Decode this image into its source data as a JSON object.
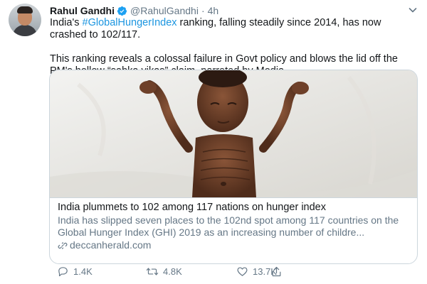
{
  "tweet": {
    "display_name": "Rahul Gandhi",
    "handle": "@RahulGandhi",
    "separator": "·",
    "time": "4h",
    "text_line1_prefix": "India's ",
    "hashtag": "#GlobalHungerIndex",
    "text_line1_suffix": " ranking, falling steadily since 2014, has now crashed to 102/117.",
    "text_paragraph2": "This ranking reveals a colossal failure in Govt policy and blows the lid off the PM's hollow “sabka vikas” claim, parroted by Modia."
  },
  "card": {
    "title": "India plummets to 102 among 117 nations on hunger index",
    "description": "India has slipped seven places to the 102nd spot among 117 countries on the Global Hunger Index (GHI) 2019 as an increasing number of childre...",
    "domain": "deccanherald.com"
  },
  "actions": {
    "reply_count": "1.4K",
    "retweet_count": "4.8K",
    "like_count": "13.7K"
  },
  "colors": {
    "link": "#1b95e0",
    "muted": "#657786",
    "verified": "#1da1f2",
    "border": "#ccd6dd"
  },
  "icons": {
    "verified": "verified-badge-icon",
    "caret": "chevron-down-icon",
    "reply": "reply-icon",
    "retweet": "retweet-icon",
    "like": "heart-icon",
    "share": "share-icon",
    "link": "link-icon"
  }
}
